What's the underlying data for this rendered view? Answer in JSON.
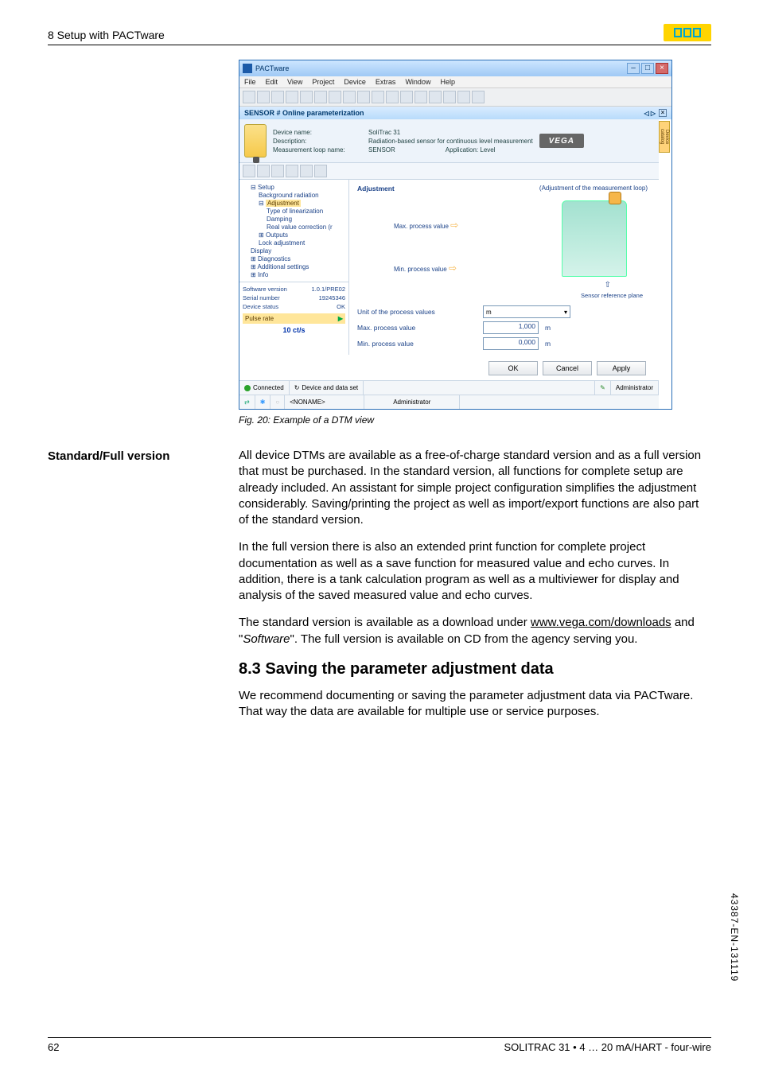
{
  "header": {
    "title": "8 Setup with PACTware"
  },
  "screenshot": {
    "window_title": "PACTware",
    "menu": [
      "File",
      "Edit",
      "View",
      "Project",
      "Device",
      "Extras",
      "Window",
      "Help"
    ],
    "subheader": "SENSOR # Online parameterization",
    "vtab": "Device catalog",
    "devinfo": {
      "name_label": "Device name:",
      "name_val": "SoliTrac 31",
      "desc_label": "Description:",
      "desc_val": "Radiation-based sensor for continuous level measurement",
      "loop_label": "Measurement loop name:",
      "loop_val": "SENSOR",
      "app_label": "Application:",
      "app_val": "Level",
      "logo": "VEGA"
    },
    "tree": {
      "root": "Setup",
      "items": [
        "Background radiation",
        "Adjustment",
        "Type of linearization",
        "Damping",
        "Real value correction (r",
        "Outputs",
        "Lock adjustment",
        "Display",
        "Diagnostics",
        "Additional settings",
        "Info"
      ],
      "stats": {
        "sw_label": "Software version",
        "sw_val": "1.0.1/PRE02",
        "sn_label": "Serial number",
        "sn_val": "19245346",
        "ds_label": "Device status",
        "ds_val": "OK",
        "pr_label": "Pulse rate",
        "pr_arrow": "▶",
        "pr_val": "10 ct/s"
      }
    },
    "main": {
      "title": "Adjustment",
      "subtitle": "(Adjustment of the measurement loop)",
      "max_label": "Max. process value",
      "min_label": "Min. process value",
      "ref_label": "Sensor reference plane",
      "unit_label": "Unit of the process values",
      "unit_val": "m",
      "maxv_label": "Max. process value",
      "maxv_val": "1,000",
      "maxv_unit": "m",
      "minv_label": "Min. process value",
      "minv_val": "0,000",
      "minv_unit": "m"
    },
    "buttons": {
      "ok": "OK",
      "cancel": "Cancel",
      "apply": "Apply"
    },
    "status1": {
      "connected": "Connected",
      "dds": "Device and data set",
      "admin": "Administrator"
    },
    "status2": {
      "noname": "<NONAME>",
      "admin": "Administrator"
    }
  },
  "caption": "Fig. 20: Example of a DTM view",
  "section": {
    "side": "Standard/Full version",
    "p1": "All device DTMs are available as a free-of-charge standard version and as a full version that must be purchased. In the standard version, all functions for complete setup are already included. An assistant for simple project configuration simplifies the adjustment considerably. Saving/printing the project as well as import/export functions are also part of the standard version.",
    "p2": "In the full version there is also an extended print function for complete project documentation as well as a save function for measured value and echo curves. In addition, there is a tank calculation program as well as a multiviewer for display and analysis of the saved measured value and echo curves.",
    "p3a": "The standard version is available as a download under ",
    "p3link": "www.vega.com/downloads",
    "p3b": " and \"",
    "p3i": "Software",
    "p3c": "\". The full version is available on CD from the agency serving you."
  },
  "h2": "8.3   Saving the parameter adjustment data",
  "p4": "We recommend documenting or saving the parameter adjustment data via PACTware. That way the data are available for multiple use or service purposes.",
  "footer": {
    "page": "62",
    "doc": "SOLITRAC 31 • 4 … 20 mA/HART - four-wire"
  },
  "docnum": "43387-EN-131119"
}
